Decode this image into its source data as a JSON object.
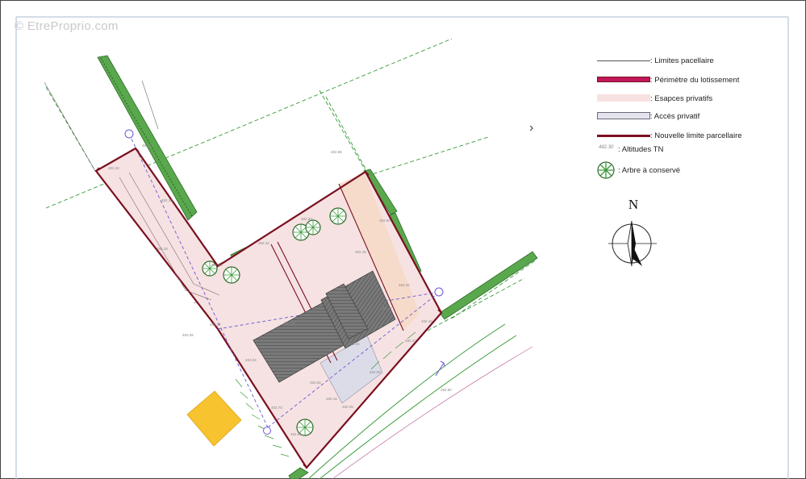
{
  "watermark": "© EtreProprio.com",
  "legend": {
    "items": [
      {
        "label": ": Limites pacellaire",
        "symbol": "thin-line",
        "color": "#555555"
      },
      {
        "label": ": Périmètre du lotissement",
        "symbol": "thick-bar",
        "color": "#c2185b"
      },
      {
        "label": ": Esapces privatifs",
        "symbol": "fill-box",
        "color": "#f7e1e1"
      },
      {
        "label": ": Accès privatif",
        "symbol": "outlined-box",
        "color": "#e4e4ee"
      },
      {
        "label": ": Nouvelle limite parcellaire",
        "symbol": "thick-line",
        "color": "#7a1020"
      },
      {
        "label": ": Altitudes TN",
        "symbol": "altitude-tag",
        "sample": "482.30"
      },
      {
        "label": ": Arbre à conservé",
        "symbol": "tree",
        "color": "#3a9a3a"
      }
    ]
  },
  "north": {
    "label": "N"
  },
  "colors": {
    "frame": "#b9c6d6",
    "perimeter": "#7a1020",
    "private_fill": "#f6e2e2",
    "orange_fill": "#f6d9c6",
    "building": "#6a6a6a",
    "hedge": "#4f9a44",
    "dashed_green": "#3a9a3a",
    "dashed_violet": "#6b57d6",
    "parking": "#f7c32e"
  },
  "icons": [
    "chevron-right-icon",
    "north-arrow-icon",
    "tree-icon"
  ]
}
